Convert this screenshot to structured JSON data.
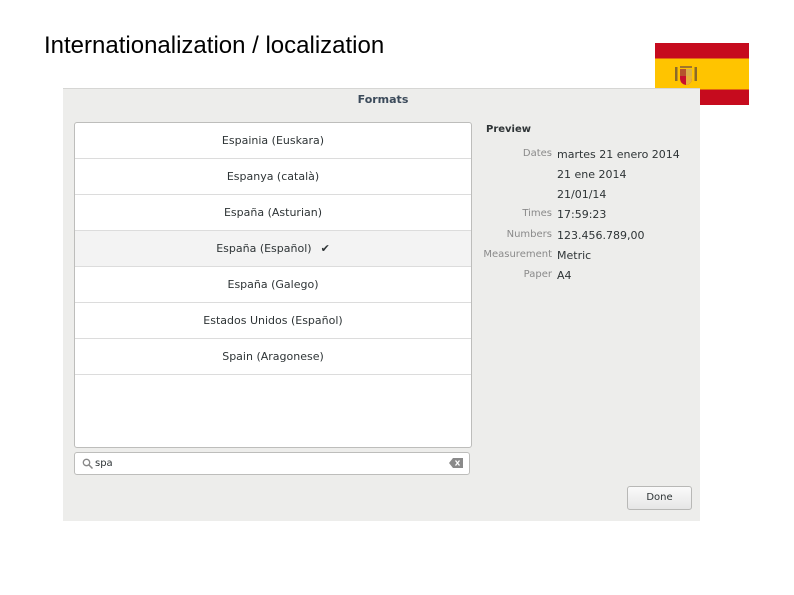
{
  "slide": {
    "title": "Internationalization / localization"
  },
  "dialog": {
    "title": "Formats",
    "items": [
      {
        "label": "Espainia (Euskara)",
        "selected": false
      },
      {
        "label": "Espanya (català)",
        "selected": false
      },
      {
        "label": "España (Asturian)",
        "selected": false
      },
      {
        "label": "España (Español)",
        "selected": true
      },
      {
        "label": "España (Galego)",
        "selected": false
      },
      {
        "label": "Estados Unidos (Español)",
        "selected": false
      },
      {
        "label": "Spain (Aragonese)",
        "selected": false
      }
    ],
    "search": {
      "value": "spa"
    },
    "preview": {
      "title": "Preview",
      "dates_label": "Dates",
      "dates": [
        "martes 21 enero 2014",
        "21 ene 2014",
        "21/01/14"
      ],
      "times_label": "Times",
      "times": "17:59:23",
      "numbers_label": "Numbers",
      "numbers": "123.456.789,00",
      "measurement_label": "Measurement",
      "measurement": "Metric",
      "paper_label": "Paper",
      "paper": "A4"
    },
    "done_label": "Done"
  },
  "colors": {
    "flag_red": "#c60b1e",
    "flag_yellow": "#ffc400"
  },
  "icons": [
    "search-icon",
    "clear-icon",
    "checkmark-icon",
    "coat-of-arms-icon"
  ]
}
